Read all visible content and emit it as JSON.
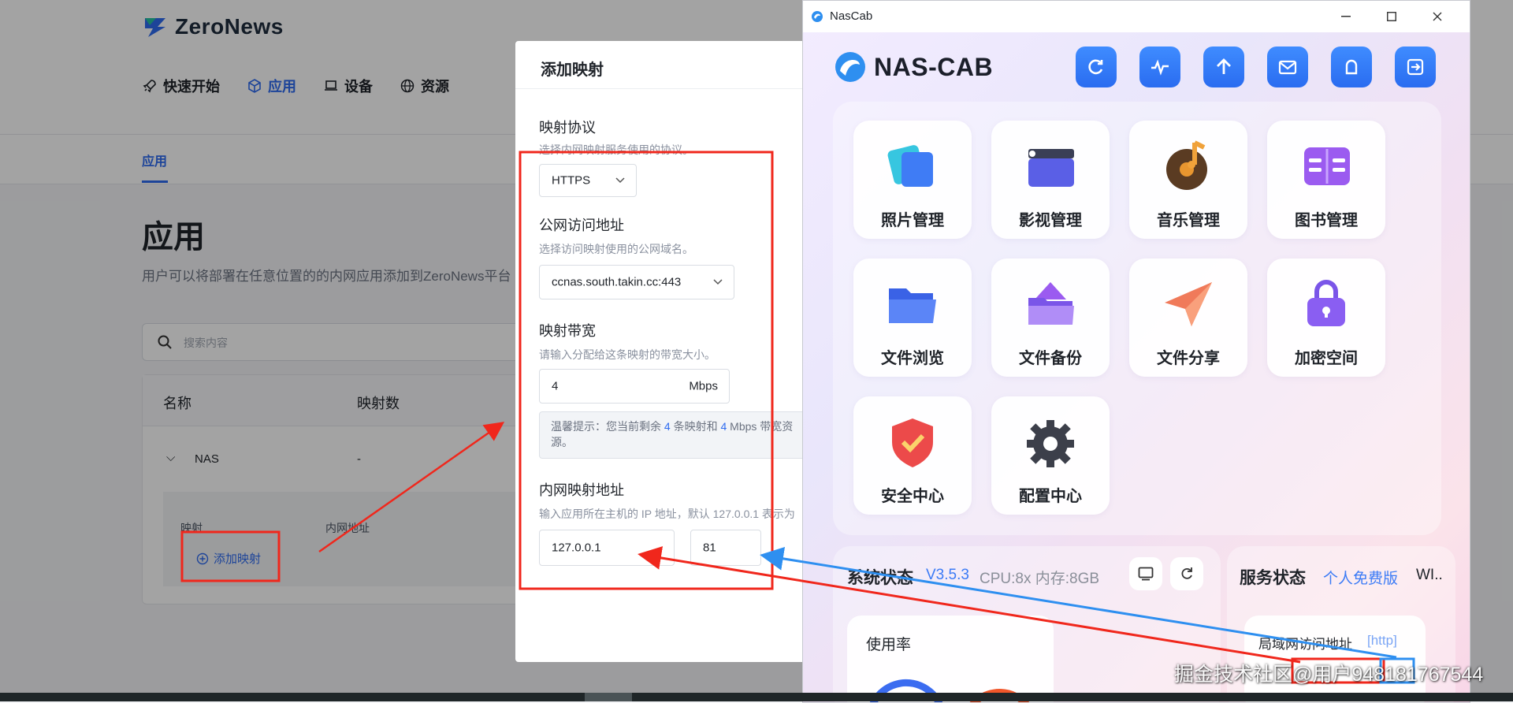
{
  "zeronews": {
    "logo_text": "ZeroNews",
    "nav": [
      {
        "label": "快速开始",
        "icon": "rocket-icon"
      },
      {
        "label": "应用",
        "icon": "cube-icon"
      },
      {
        "label": "设备",
        "icon": "laptop-icon"
      },
      {
        "label": "资源",
        "icon": "globe-icon"
      }
    ],
    "subtab": "应用",
    "page_title": "应用",
    "description": "用户可以将部署在任意位置的的内网应用添加到ZeroNews平台",
    "search_placeholder": "搜索内容",
    "table": {
      "columns": [
        "名称",
        "映射数"
      ],
      "row": {
        "name": "NAS",
        "mappings": "-"
      },
      "sub_columns": [
        "映射",
        "内网地址"
      ],
      "add_mapping": "添加映射"
    }
  },
  "drawer": {
    "title": "添加映射",
    "protocol": {
      "label": "映射协议",
      "help": "选择内网映射服务使用的协议。",
      "value": "HTTPS"
    },
    "public_address": {
      "label": "公网访问地址",
      "help": "选择访问映射使用的公网域名。",
      "value": "ccnas.south.takin.cc:443"
    },
    "bandwidth": {
      "label": "映射带宽",
      "help": "请输入分配给这条映射的带宽大小。",
      "value": "4",
      "unit": "Mbps"
    },
    "tip": {
      "prefix": "温馨提示：您当前剩余",
      "count": "4",
      "middle": "条映射和",
      "bw": "4",
      "suffix": "Mbps 带宽资",
      "line2": "源。"
    },
    "internal_address": {
      "label": "内网映射地址",
      "help": "输入应用所在主机的 IP 地址，默认 127.0.0.1 表示为",
      "ip": "127.0.0.1",
      "port": "81"
    }
  },
  "nascab": {
    "window_title": "NasCab",
    "logo_text": "NAS-CAB",
    "top_buttons": [
      "refresh-icon",
      "pulse-icon",
      "upload-icon",
      "mail-icon",
      "user-icon",
      "logout-icon"
    ],
    "apps": [
      {
        "label": "照片管理",
        "icon": "photos-icon"
      },
      {
        "label": "影视管理",
        "icon": "clapperboard-icon"
      },
      {
        "label": "音乐管理",
        "icon": "music-disc-icon"
      },
      {
        "label": "图书管理",
        "icon": "book-icon"
      },
      {
        "label": "文件浏览",
        "icon": "folder-icon"
      },
      {
        "label": "文件备份",
        "icon": "backup-folder-icon"
      },
      {
        "label": "文件分享",
        "icon": "paper-plane-icon"
      },
      {
        "label": "加密空间",
        "icon": "lock-icon"
      },
      {
        "label": "安全中心",
        "icon": "shield-icon"
      },
      {
        "label": "配置中心",
        "icon": "gear-icon"
      }
    ],
    "system_status": {
      "title": "系统状态",
      "version": "V3.5.3",
      "cpu": "CPU:8x 内存:8GB",
      "usage_label": "使用率"
    },
    "service_status": {
      "title": "服务状态",
      "edition": "个人免费版",
      "more": "WI..",
      "lan_label": "局域网访问地址",
      "lan_proto": "[http]"
    }
  },
  "watermark": "掘金技术社区@用户9481817675​44",
  "colors": {
    "accent": "#2e6bf0",
    "annotation_red": "#f0271c",
    "annotation_blue": "#2e8ff0"
  }
}
